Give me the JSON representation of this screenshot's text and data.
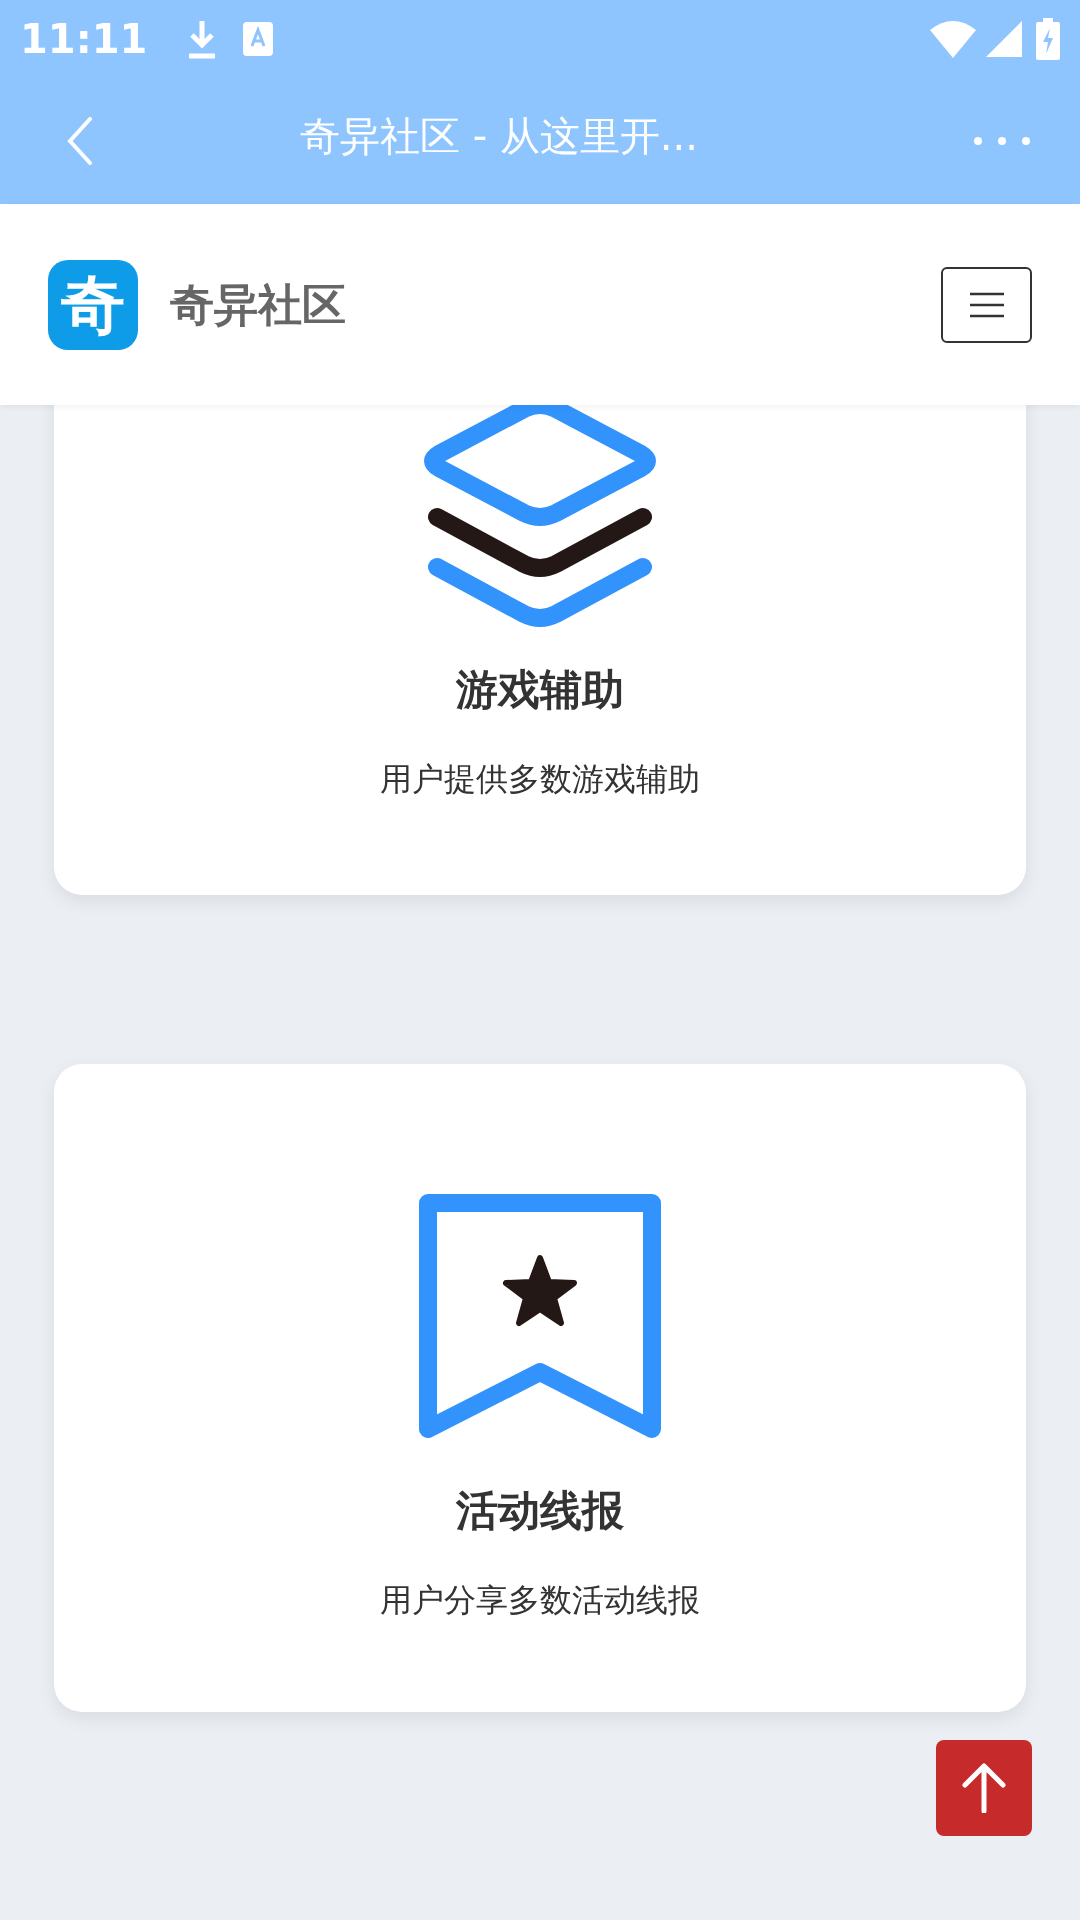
{
  "status_bar": {
    "time": "11:11"
  },
  "toolbar": {
    "title": "奇异社区 - 从这里开..."
  },
  "site_header": {
    "logo_text": "奇",
    "name": "奇异社区"
  },
  "cards": [
    {
      "kind": "layers",
      "title": "游戏辅助",
      "description": "用户提供多数游戏辅助"
    },
    {
      "kind": "bookmark",
      "title": "活动线报",
      "description": "用户分享多数活动线报"
    }
  ]
}
